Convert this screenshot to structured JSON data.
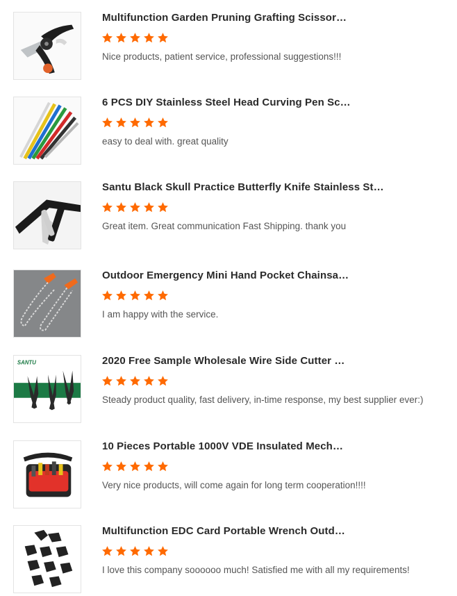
{
  "theme": {
    "star_color": "#ff6a00",
    "title_color": "#2a2a2a",
    "comment_color": "#555555",
    "border_color": "#e3e3e3"
  },
  "reviews": [
    {
      "title": "Multifunction Garden Pruning Grafting Scissor…",
      "rating": 5,
      "comment": "Nice products, patient service, professional suggestions!!!",
      "image": "pruning-scissors-image"
    },
    {
      "title": "6 PCS DIY Stainless Steel Head Curving Pen Sc…",
      "rating": 5,
      "comment": "easy to deal with. great quality",
      "image": "curving-pens-image"
    },
    {
      "title": "Santu Black Skull Practice Butterfly Knife Stainless St…",
      "rating": 5,
      "comment": "Great item. Great communication Fast Shipping. thank you",
      "image": "butterfly-knife-image"
    },
    {
      "title": "Outdoor Emergency Mini Hand Pocket Chainsa…",
      "rating": 5,
      "comment": "I am happy with the service.",
      "image": "pocket-chainsaw-image"
    },
    {
      "title": "2020 Free Sample Wholesale Wire Side Cutter …",
      "rating": 5,
      "comment": "Steady product quality, fast delivery, in-time response, my best supplier ever:)",
      "image": "wire-cutter-image",
      "brand": "SANTU"
    },
    {
      "title": "10 Pieces Portable 1000V VDE Insulated Mech…",
      "rating": 5,
      "comment": "Very nice products, will come again for long term cooperation!!!!",
      "image": "tool-bag-image"
    },
    {
      "title": "Multifunction EDC Card Portable Wrench Outd…",
      "rating": 5,
      "comment": "I love this company soooooo much! Satisfied me with all my requirements!",
      "image": "edc-wrench-image"
    }
  ]
}
